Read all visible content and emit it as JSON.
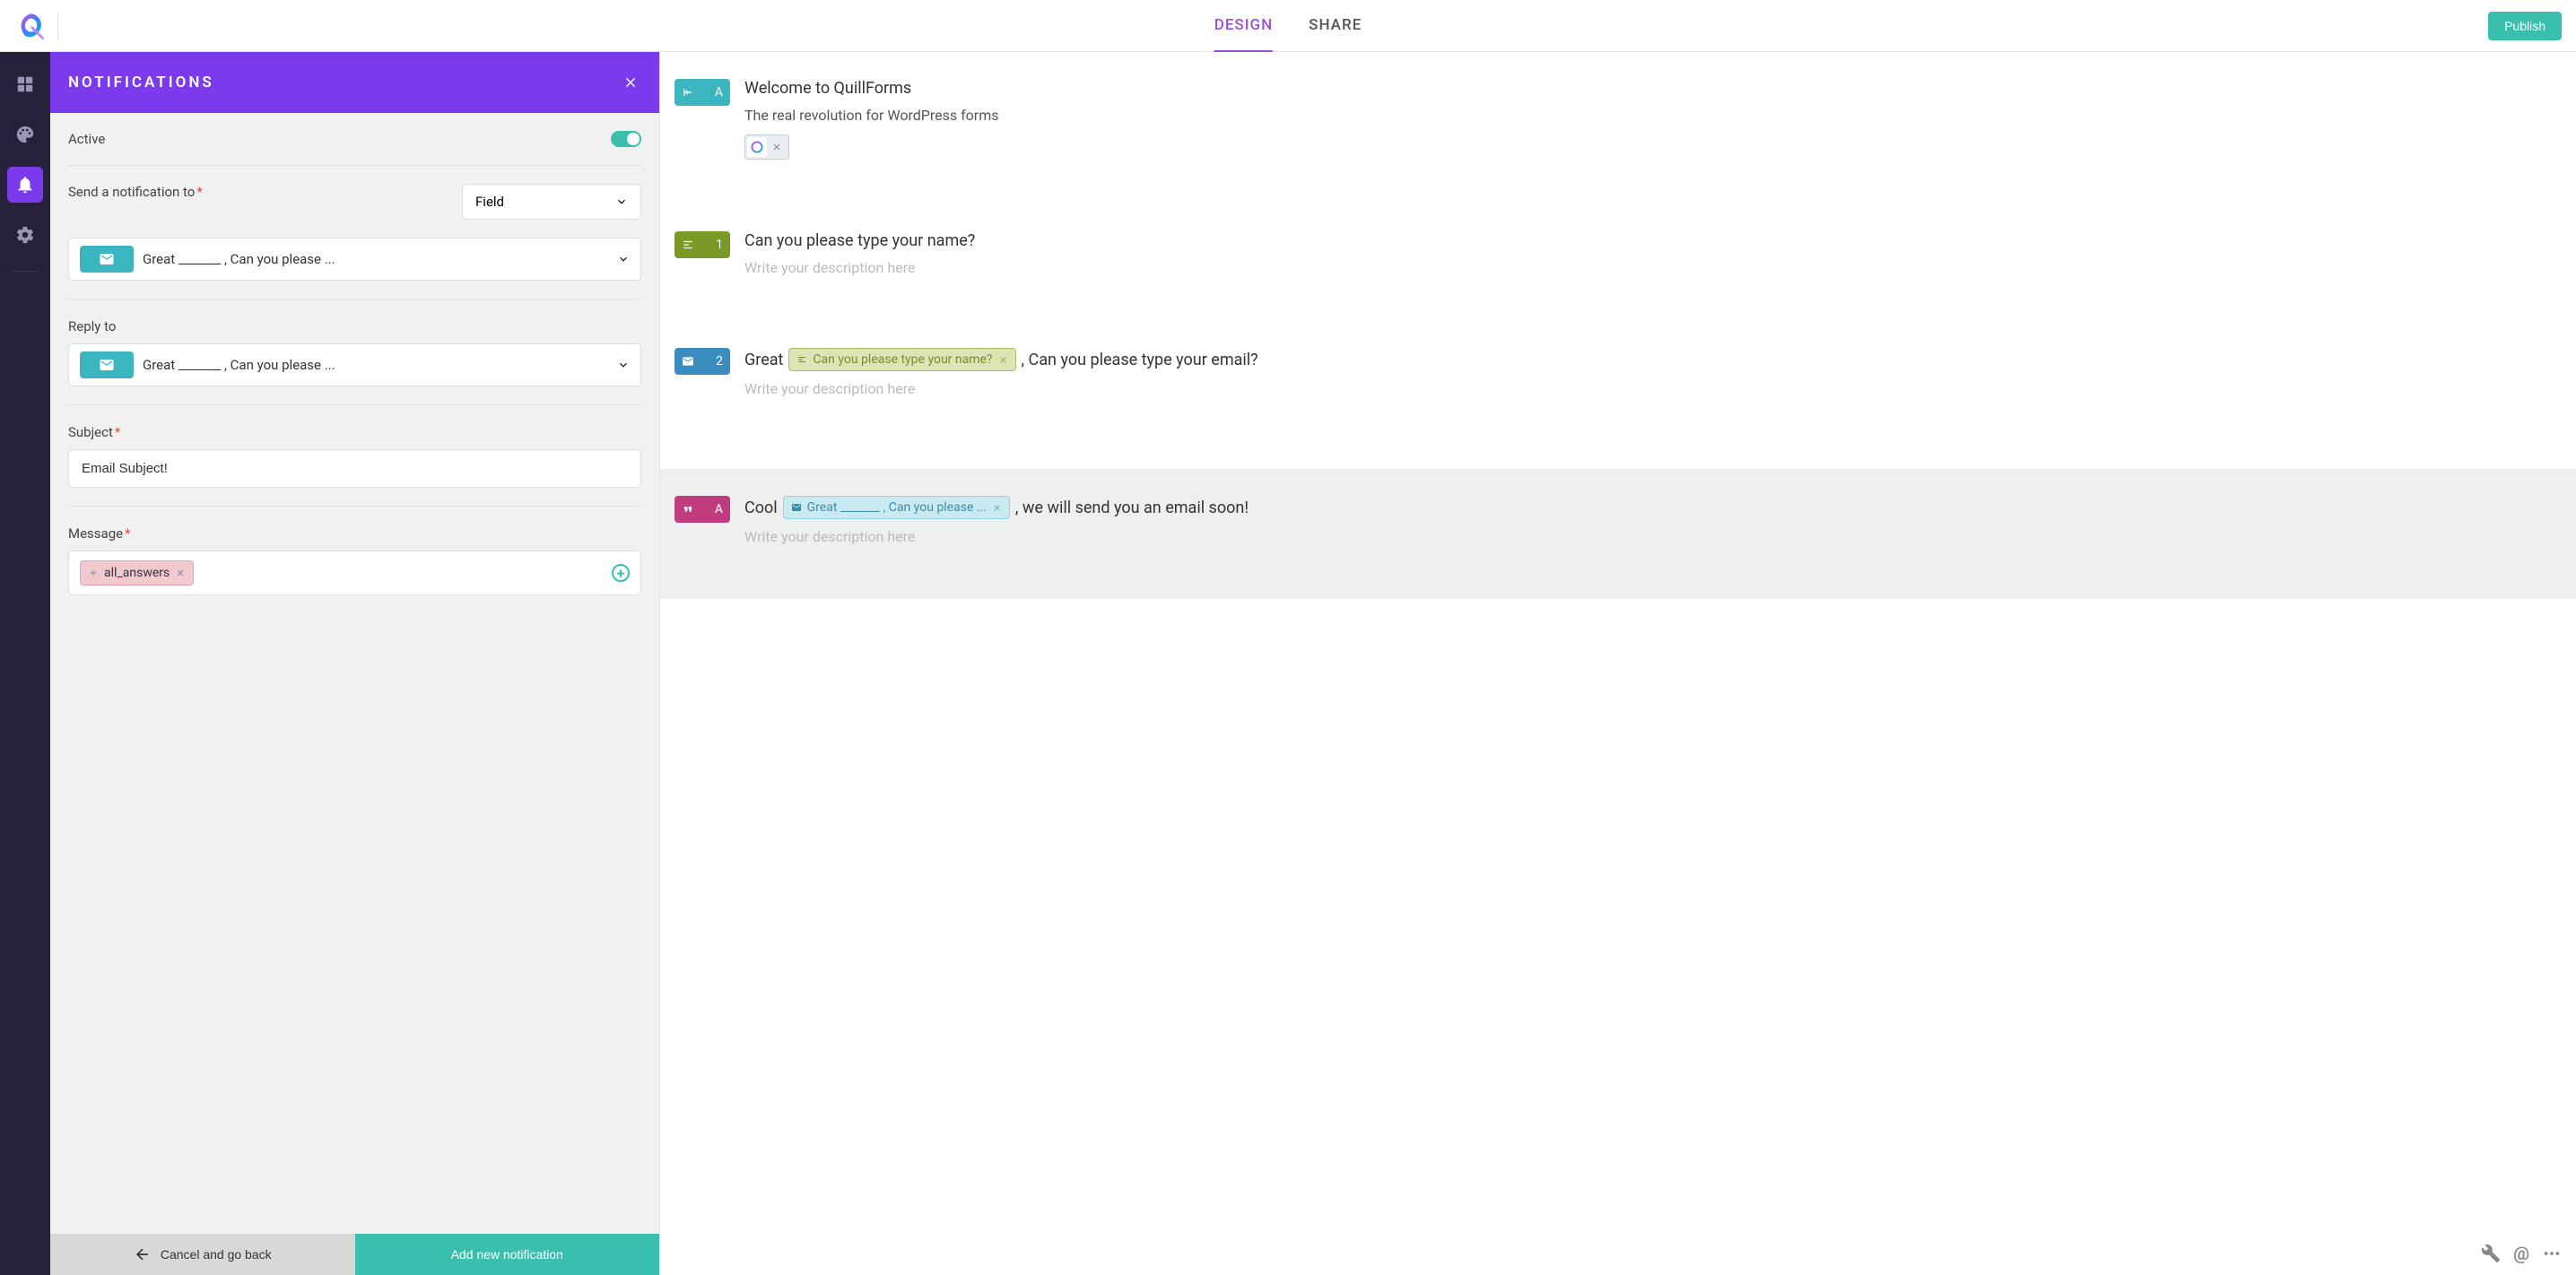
{
  "topbar": {
    "tabs": {
      "design": "DESIGN",
      "share": "SHARE"
    },
    "publish": "Publish"
  },
  "panel": {
    "title": "NOTIFICATIONS",
    "active_label": "Active",
    "send_to_label": "Send a notification to",
    "send_to_type": "Field",
    "send_to_value": "Great _______ , Can you please ...",
    "reply_to_label": "Reply to",
    "reply_to_value": "Great _______ , Can you please ...",
    "subject_label": "Subject",
    "subject_value": "Email Subject!",
    "message_label": "Message",
    "message_chip": "all_answers",
    "footer": {
      "cancel": "Cancel and go back",
      "add": "Add new notification"
    }
  },
  "canvas": {
    "blocks": {
      "welcome": {
        "badge": "A",
        "title": "Welcome to QuillForms",
        "sub": "The real revolution for WordPress forms"
      },
      "q1": {
        "badge": "1",
        "title": "Can you please type your name?",
        "desc": "Write your description here"
      },
      "q2": {
        "badge": "2",
        "title_pre": "Great",
        "chip": "Can you please type your name?",
        "title_post": ", Can you please type your email?",
        "desc": "Write your description here"
      },
      "thanks": {
        "badge": "A",
        "title_pre": "Cool",
        "chip": "Great _______ , Can you please ...",
        "title_post": ", we will send you an email soon!",
        "desc": "Write your description here"
      }
    }
  }
}
